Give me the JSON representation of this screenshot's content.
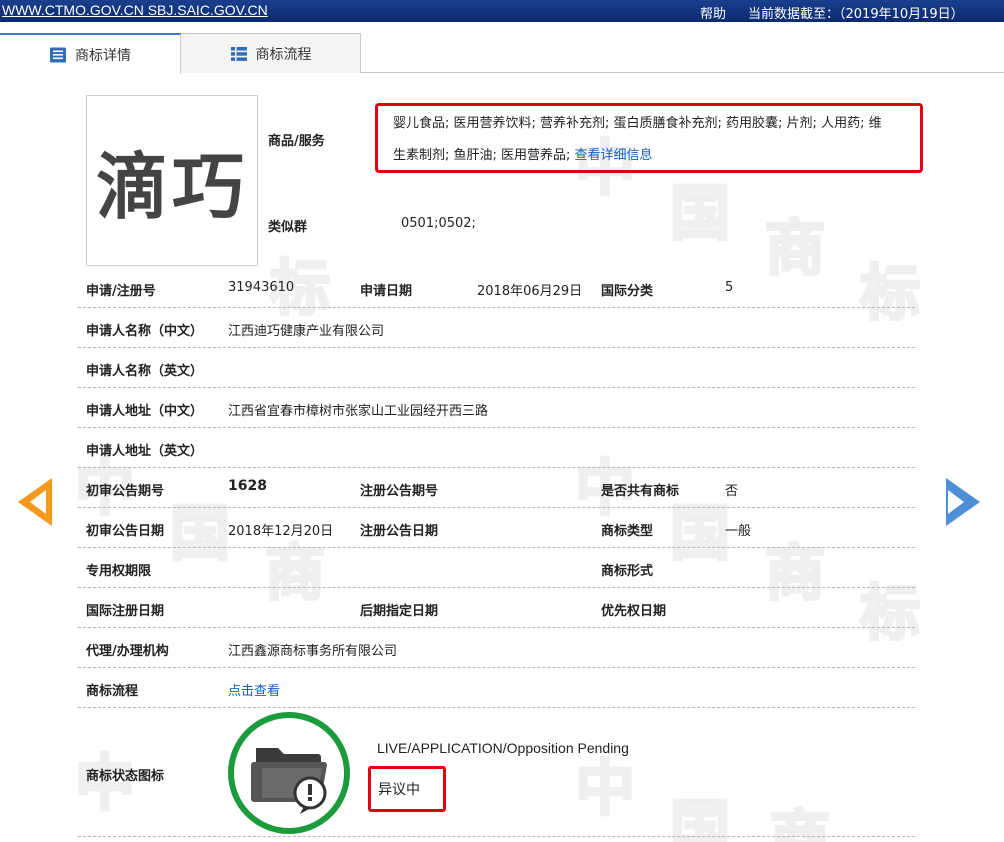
{
  "topbar": {
    "site": "WWW.CTMO.GOV.CN SBJ.SAIC.GOV.CN",
    "help": "帮助",
    "data_date": "当前数据截至：（2019年10月19日）"
  },
  "tabs": [
    {
      "label": "商标详情",
      "active": true
    },
    {
      "label": "商标流程",
      "active": false
    }
  ],
  "logo_text": "滴巧",
  "watermark_chars": [
    "中",
    "国",
    "商",
    "标"
  ],
  "goods": {
    "label": "商品/服务",
    "line1": "婴儿食品; 医用营养饮料; 营养补充剂; 蛋白质膳食补充剂; 药用胶囊; 片剂; 人用药; 维",
    "line2": "生素制剂; 鱼肝油; 医用营养品;",
    "more_link": "查看详细信息"
  },
  "similar_group": {
    "label": "类似群",
    "value": "0501;0502;"
  },
  "fields": {
    "reg_no_label": "申请/注册号",
    "reg_no": "31943610",
    "apply_date_label": "申请日期",
    "apply_date": "2018年06月29日",
    "intl_class_label": "国际分类",
    "intl_class": "5",
    "applicant_cn_label": "申请人名称（中文）",
    "applicant_cn": "江西迪巧健康产业有限公司",
    "applicant_en_label": "申请人名称（英文）",
    "applicant_en": "",
    "address_cn_label": "申请人地址（中文）",
    "address_cn": "江西省宜春市樟树市张家山工业园经开西三路",
    "address_en_label": "申请人地址（英文）",
    "address_en": "",
    "prelim_no_label": "初审公告期号",
    "prelim_no": "1628",
    "reg_pub_no_label": "注册公告期号",
    "reg_pub_no": "",
    "shared_label": "是否共有商标",
    "shared": "否",
    "prelim_date_label": "初审公告日期",
    "prelim_date": "2018年12月20日",
    "reg_pub_date_label": "注册公告日期",
    "reg_pub_date": "",
    "tm_type_label": "商标类型",
    "tm_type": "一般",
    "exclusive_label": "专用权期限",
    "exclusive": "",
    "tm_form_label": "商标形式",
    "tm_form": "",
    "intl_reg_date_label": "国际注册日期",
    "intl_reg_date": "",
    "later_date_label": "后期指定日期",
    "later_date": "",
    "priority_date_label": "优先权日期",
    "priority_date": "",
    "agent_label": "代理/办理机构",
    "agent": "江西鑫源商标事务所有限公司",
    "flow_label": "商标流程",
    "flow_link": "点击查看",
    "status_icon_label": "商标状态图标"
  },
  "status": {
    "en": "LIVE/APPLICATION/Opposition Pending",
    "cn": "异议中"
  },
  "colors": {
    "topbar": "#0c2a6e",
    "highlight_border": "#e3000f",
    "link": "#1a5fb4",
    "status_ring": "#1c9b3c",
    "prev_arrow": "#f39a1e",
    "next_arrow": "#4f8fd8"
  }
}
